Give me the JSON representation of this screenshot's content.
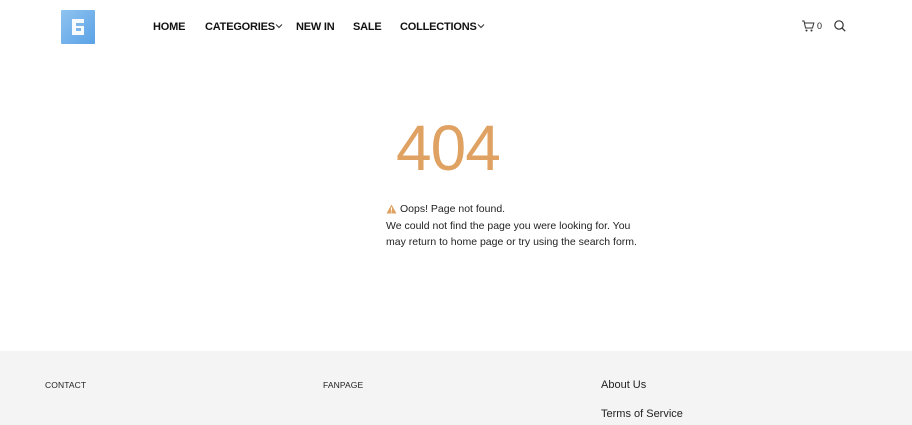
{
  "brand": {
    "accent": "#e0a262",
    "logo_color": "#5aa2e6"
  },
  "header": {
    "nav": [
      {
        "label": "HOME",
        "has_dropdown": false
      },
      {
        "label": "CATEGORIES",
        "has_dropdown": true
      },
      {
        "label": "NEW IN",
        "has_dropdown": false
      },
      {
        "label": "SALE",
        "has_dropdown": false
      },
      {
        "label": "COLLECTIONS",
        "has_dropdown": true
      }
    ],
    "cart_count": "0",
    "icons": {
      "cart": "cart-icon",
      "search": "search-icon",
      "dropdown": "chevron-down-icon"
    }
  },
  "error": {
    "code": "404",
    "title": "Oops! Page not found.",
    "line1": "We could not find the page you were looking for. You",
    "line2": "may return to home page or try using the search form.",
    "icon": "warning-icon"
  },
  "footer": {
    "contact_heading": "CONTACT",
    "fanpage_heading": "FANPAGE",
    "links": [
      "About Us",
      "Terms of Service"
    ]
  }
}
